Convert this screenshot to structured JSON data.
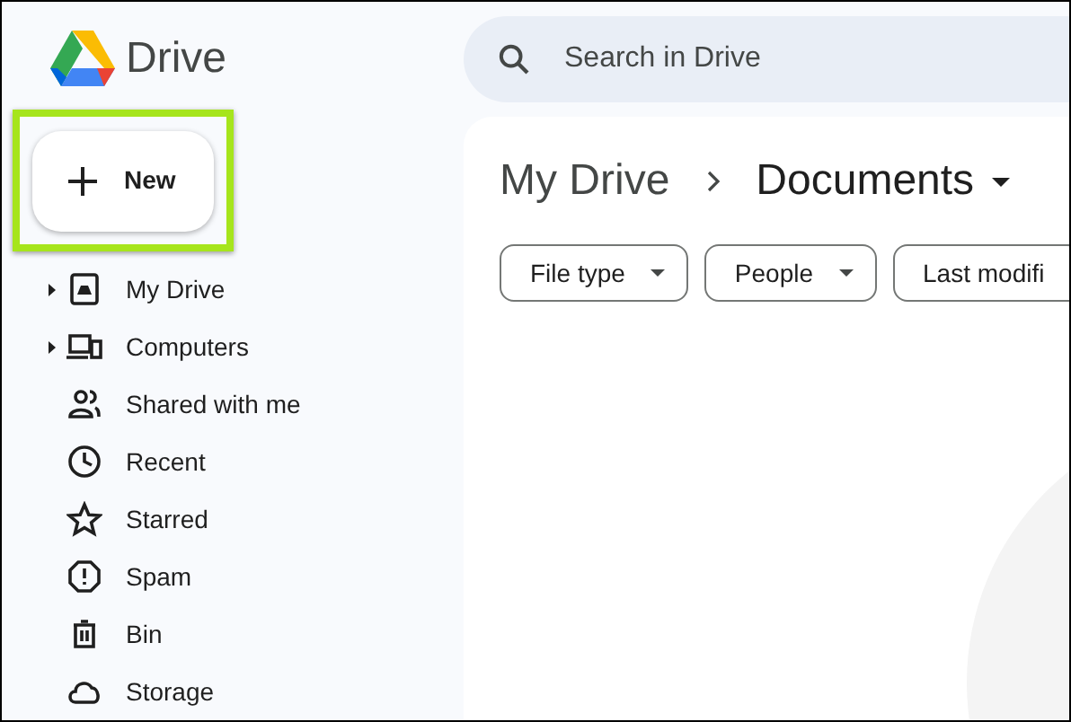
{
  "app": {
    "name": "Drive"
  },
  "search": {
    "placeholder": "Search in Drive"
  },
  "new_button": {
    "label": "New",
    "highlighted": true
  },
  "sidebar": {
    "items": [
      {
        "label": "My Drive",
        "expandable": true
      },
      {
        "label": "Computers",
        "expandable": true
      },
      {
        "label": "Shared with me",
        "expandable": false
      },
      {
        "label": "Recent",
        "expandable": false
      },
      {
        "label": "Starred",
        "expandable": false
      },
      {
        "label": "Spam",
        "expandable": false
      },
      {
        "label": "Bin",
        "expandable": false
      },
      {
        "label": "Storage",
        "expandable": false
      }
    ]
  },
  "breadcrumb": [
    "My Drive",
    "Documents"
  ],
  "filters": [
    {
      "label": "File type",
      "dropdown": true
    },
    {
      "label": "People",
      "dropdown": true
    },
    {
      "label": "Last modifi",
      "dropdown": false
    }
  ]
}
